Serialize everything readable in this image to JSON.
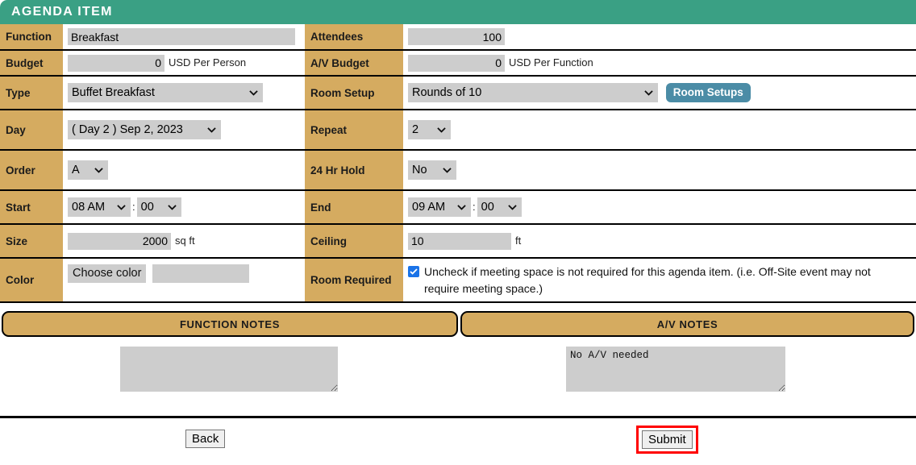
{
  "header": {
    "title": "AGENDA ITEM"
  },
  "colors": {
    "header_teal": "#3aa084",
    "label_tan": "#d5ab60",
    "field_grey": "#cdcdcd",
    "room_setups_blue": "#4b8ca6",
    "checkbox_blue": "#1a73e8",
    "highlight_red": "#ff0000"
  },
  "fields": {
    "function": {
      "label": "Function",
      "value": "Breakfast"
    },
    "attendees": {
      "label": "Attendees",
      "value": "100"
    },
    "budget": {
      "label": "Budget",
      "value": "0",
      "unit": "USD Per Person"
    },
    "av_budget": {
      "label": "A/V Budget",
      "value": "0",
      "unit": "USD Per Function"
    },
    "type": {
      "label": "Type",
      "value": "Buffet Breakfast"
    },
    "room_setup": {
      "label": "Room Setup",
      "value": "Rounds of 10",
      "button": "Room Setups"
    },
    "day": {
      "label": "Day",
      "value": "( Day 2 ) Sep 2, 2023"
    },
    "repeat": {
      "label": "Repeat",
      "value": "2"
    },
    "order": {
      "label": "Order",
      "value": "A"
    },
    "hold_24hr": {
      "label": "24 Hr Hold",
      "value": "No"
    },
    "start": {
      "label": "Start",
      "hour": "08 AM",
      "sep": ":",
      "minute": "00"
    },
    "end": {
      "label": "End",
      "hour": "09 AM",
      "sep": ":",
      "minute": "00"
    },
    "size": {
      "label": "Size",
      "value": "2000",
      "unit": "sq ft"
    },
    "ceiling": {
      "label": "Ceiling",
      "value": "10",
      "unit": "ft"
    },
    "color": {
      "label": "Color",
      "button": "Choose color"
    },
    "room_required": {
      "label": "Room Required",
      "checked": true,
      "text": "Uncheck if meeting space is not required for this agenda item. (i.e. Off-Site event may not require meeting space.)"
    }
  },
  "notes": {
    "function_tab": "FUNCTION NOTES",
    "av_tab": "A/V NOTES",
    "function_value": "",
    "function_placeholder": "",
    "av_value": "No A/V needed",
    "av_placeholder": ""
  },
  "footer": {
    "back_label": "Back",
    "submit_label": "Submit"
  }
}
